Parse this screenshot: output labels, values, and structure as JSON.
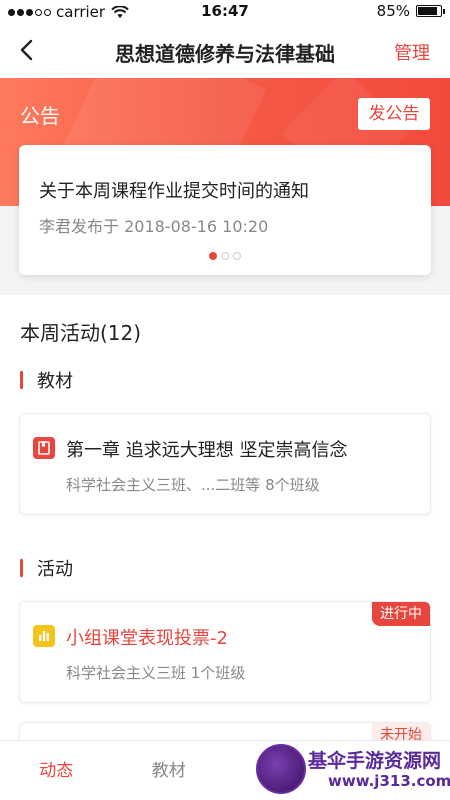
{
  "status_bar": {
    "carrier": "carrier",
    "time": "16:47",
    "battery": "85%"
  },
  "nav": {
    "title": "思想道德修养与法律基础",
    "manage": "管理"
  },
  "announcement": {
    "title": "公告",
    "post_button": "发公告",
    "notice": {
      "title": "关于本周课程作业提交时间的通知",
      "meta": "李君发布于 2018-08-16 10:20"
    },
    "pager": {
      "count": 3,
      "active": 0
    }
  },
  "week": {
    "title": "本周活动(12)"
  },
  "sections": {
    "textbook": {
      "label": "教材",
      "items": [
        {
          "title": "第一章 追求远大理想 坚定崇高信念",
          "sub": "科学社会主义三班、...二班等 8个班级",
          "icon": "book-icon"
        }
      ]
    },
    "activity": {
      "label": "活动",
      "items": [
        {
          "title": "小组课堂表现投票-2",
          "sub": "科学社会主义三班 1个班级",
          "status": "进行中",
          "icon": "chart-icon"
        },
        {
          "status": "未开始"
        }
      ]
    }
  },
  "tabs": [
    "动态",
    "教材"
  ],
  "watermark": {
    "name": "基伞手游资源网",
    "url": "www.j313.com"
  },
  "colors": {
    "accent": "#e8453c",
    "banner_start": "#ff7a5c",
    "banner_end": "#f24a3c"
  }
}
